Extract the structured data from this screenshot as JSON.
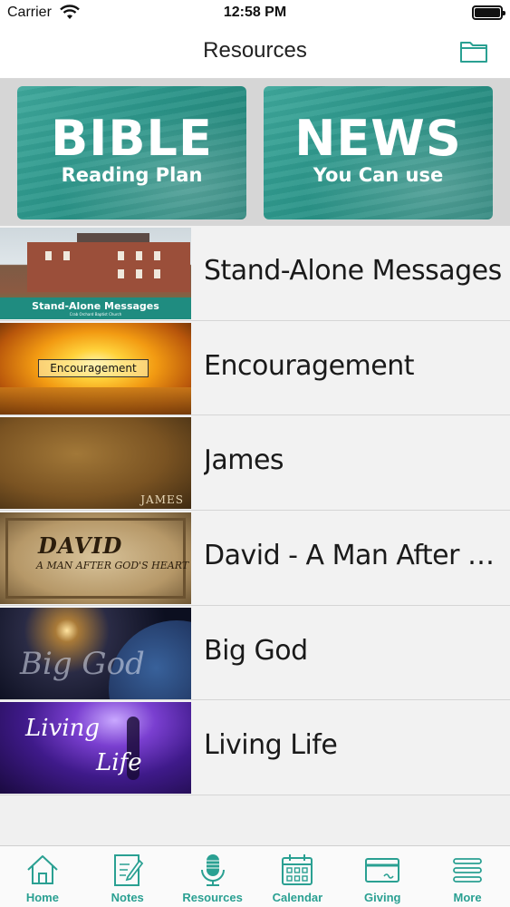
{
  "status_bar": {
    "carrier": "Carrier",
    "time": "12:58 PM"
  },
  "nav": {
    "title": "Resources",
    "right_icon": "folder-icon"
  },
  "banners": [
    {
      "big": "BIBLE",
      "small": "Reading Plan"
    },
    {
      "big": "NEWS",
      "small": "You Can use"
    }
  ],
  "items": [
    {
      "label": "Stand-Alone Messages",
      "thumb_text": "Stand-Alone Messages",
      "thumb_subtext": "Crab Orchard Baptist Church"
    },
    {
      "label": "Encouragement",
      "thumb_text": "Encouragement"
    },
    {
      "label": "James",
      "thumb_text": "JAMES"
    },
    {
      "label": "David - A Man After G…",
      "thumb_text": "DAVID",
      "thumb_subtext": "A MAN AFTER GOD'S HEART"
    },
    {
      "label": "Big God",
      "thumb_text": "Big God"
    },
    {
      "label": "Living Life",
      "thumb_text_1": "Living",
      "thumb_text_2": "Life"
    }
  ],
  "tabs": [
    {
      "label": "Home",
      "icon": "home-icon"
    },
    {
      "label": "Notes",
      "icon": "notes-icon"
    },
    {
      "label": "Resources",
      "icon": "microphone-icon"
    },
    {
      "label": "Calendar",
      "icon": "calendar-icon"
    },
    {
      "label": "Giving",
      "icon": "card-icon"
    },
    {
      "label": "More",
      "icon": "menu-icon"
    }
  ],
  "colors": {
    "accent": "#2aa092",
    "banner_teal": "#2a9488"
  }
}
